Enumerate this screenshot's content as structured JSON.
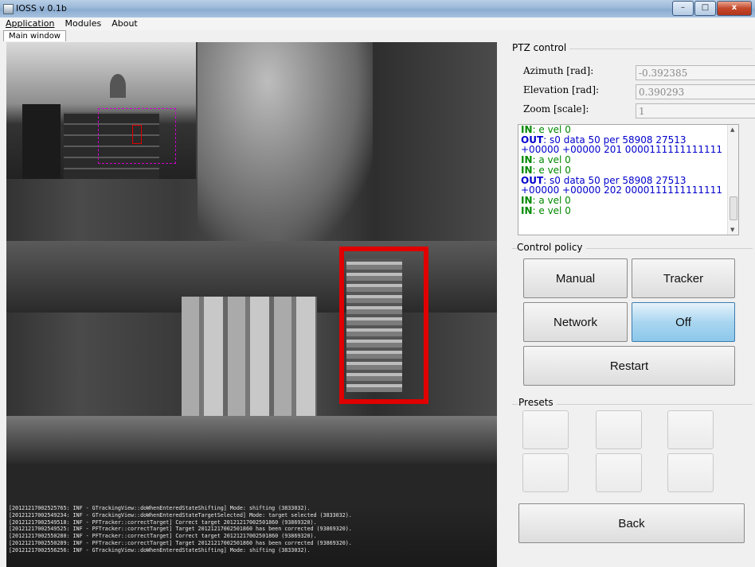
{
  "window": {
    "title": "IOSS v 0.1b",
    "minimize": "–",
    "maximize": "□",
    "close": "x"
  },
  "menu": [
    "Application",
    "Modules",
    "About"
  ],
  "tab": "Main window",
  "log_lines": [
    "[20121217002525765: INF - GTrackingView::doWhenEnteredStateShifting] Mode: shifting (3833032).",
    "[20121217002549234: INF - GTrackingView::doWhenEnteredStateTargetSelected] Mode: target selected (3833032).",
    "[20121217002549518: INF - PFTracker::correctTarget] Correct target 20121217002501860 (93869320).",
    "[20121217002549525: INF - PFTracker::correctTarget] Target 20121217002501860 has been corrected (93869320).",
    "[20121217002550280: INF - PFTracker::correctTarget] Correct target 20121217002501860 (93869320).",
    "[20121217002550289: INF - PFTracker::correctTarget] Target 20121217002501860 has been corrected (93869320).",
    "[20121217002556256: INF - GTrackingView::doWhenEnteredStateShifting] Mode: shifting (3833032)."
  ],
  "ptz": {
    "title": "PTZ control",
    "azimuth_label": "Azimuth [rad]:",
    "azimuth_value": "-0.392385",
    "elevation_label": "Elevation [rad]:",
    "elevation_value": "0.390293",
    "zoom_label": "Zoom [scale]:",
    "zoom_value": "1"
  },
  "console": [
    {
      "kind": "IN",
      "text": ": e vel 0"
    },
    {
      "kind": "OUT",
      "text": ": s0 data 50 per 58908 27513 +00000 +00000 201 0000111111111111"
    },
    {
      "kind": "IN",
      "text": ": a vel 0"
    },
    {
      "kind": "IN",
      "text": ": e vel 0"
    },
    {
      "kind": "OUT",
      "text": ": s0 data 50 per 58908 27513 +00000 +00000 202 0000111111111111"
    },
    {
      "kind": "IN",
      "text": ": a vel 0"
    },
    {
      "kind": "IN",
      "text": ": e vel 0"
    }
  ],
  "control_policy": {
    "title": "Control policy",
    "manual": "Manual",
    "tracker": "Tracker",
    "network": "Network",
    "off": "Off",
    "restart": "Restart"
  },
  "presets": {
    "title": "Presets"
  },
  "back": "Back",
  "colors": {
    "target_box": "#e00000",
    "roi": "#d000d0",
    "active_button": "#8cc7ea",
    "console_in": "#008800",
    "console_out": "#0000cc"
  }
}
